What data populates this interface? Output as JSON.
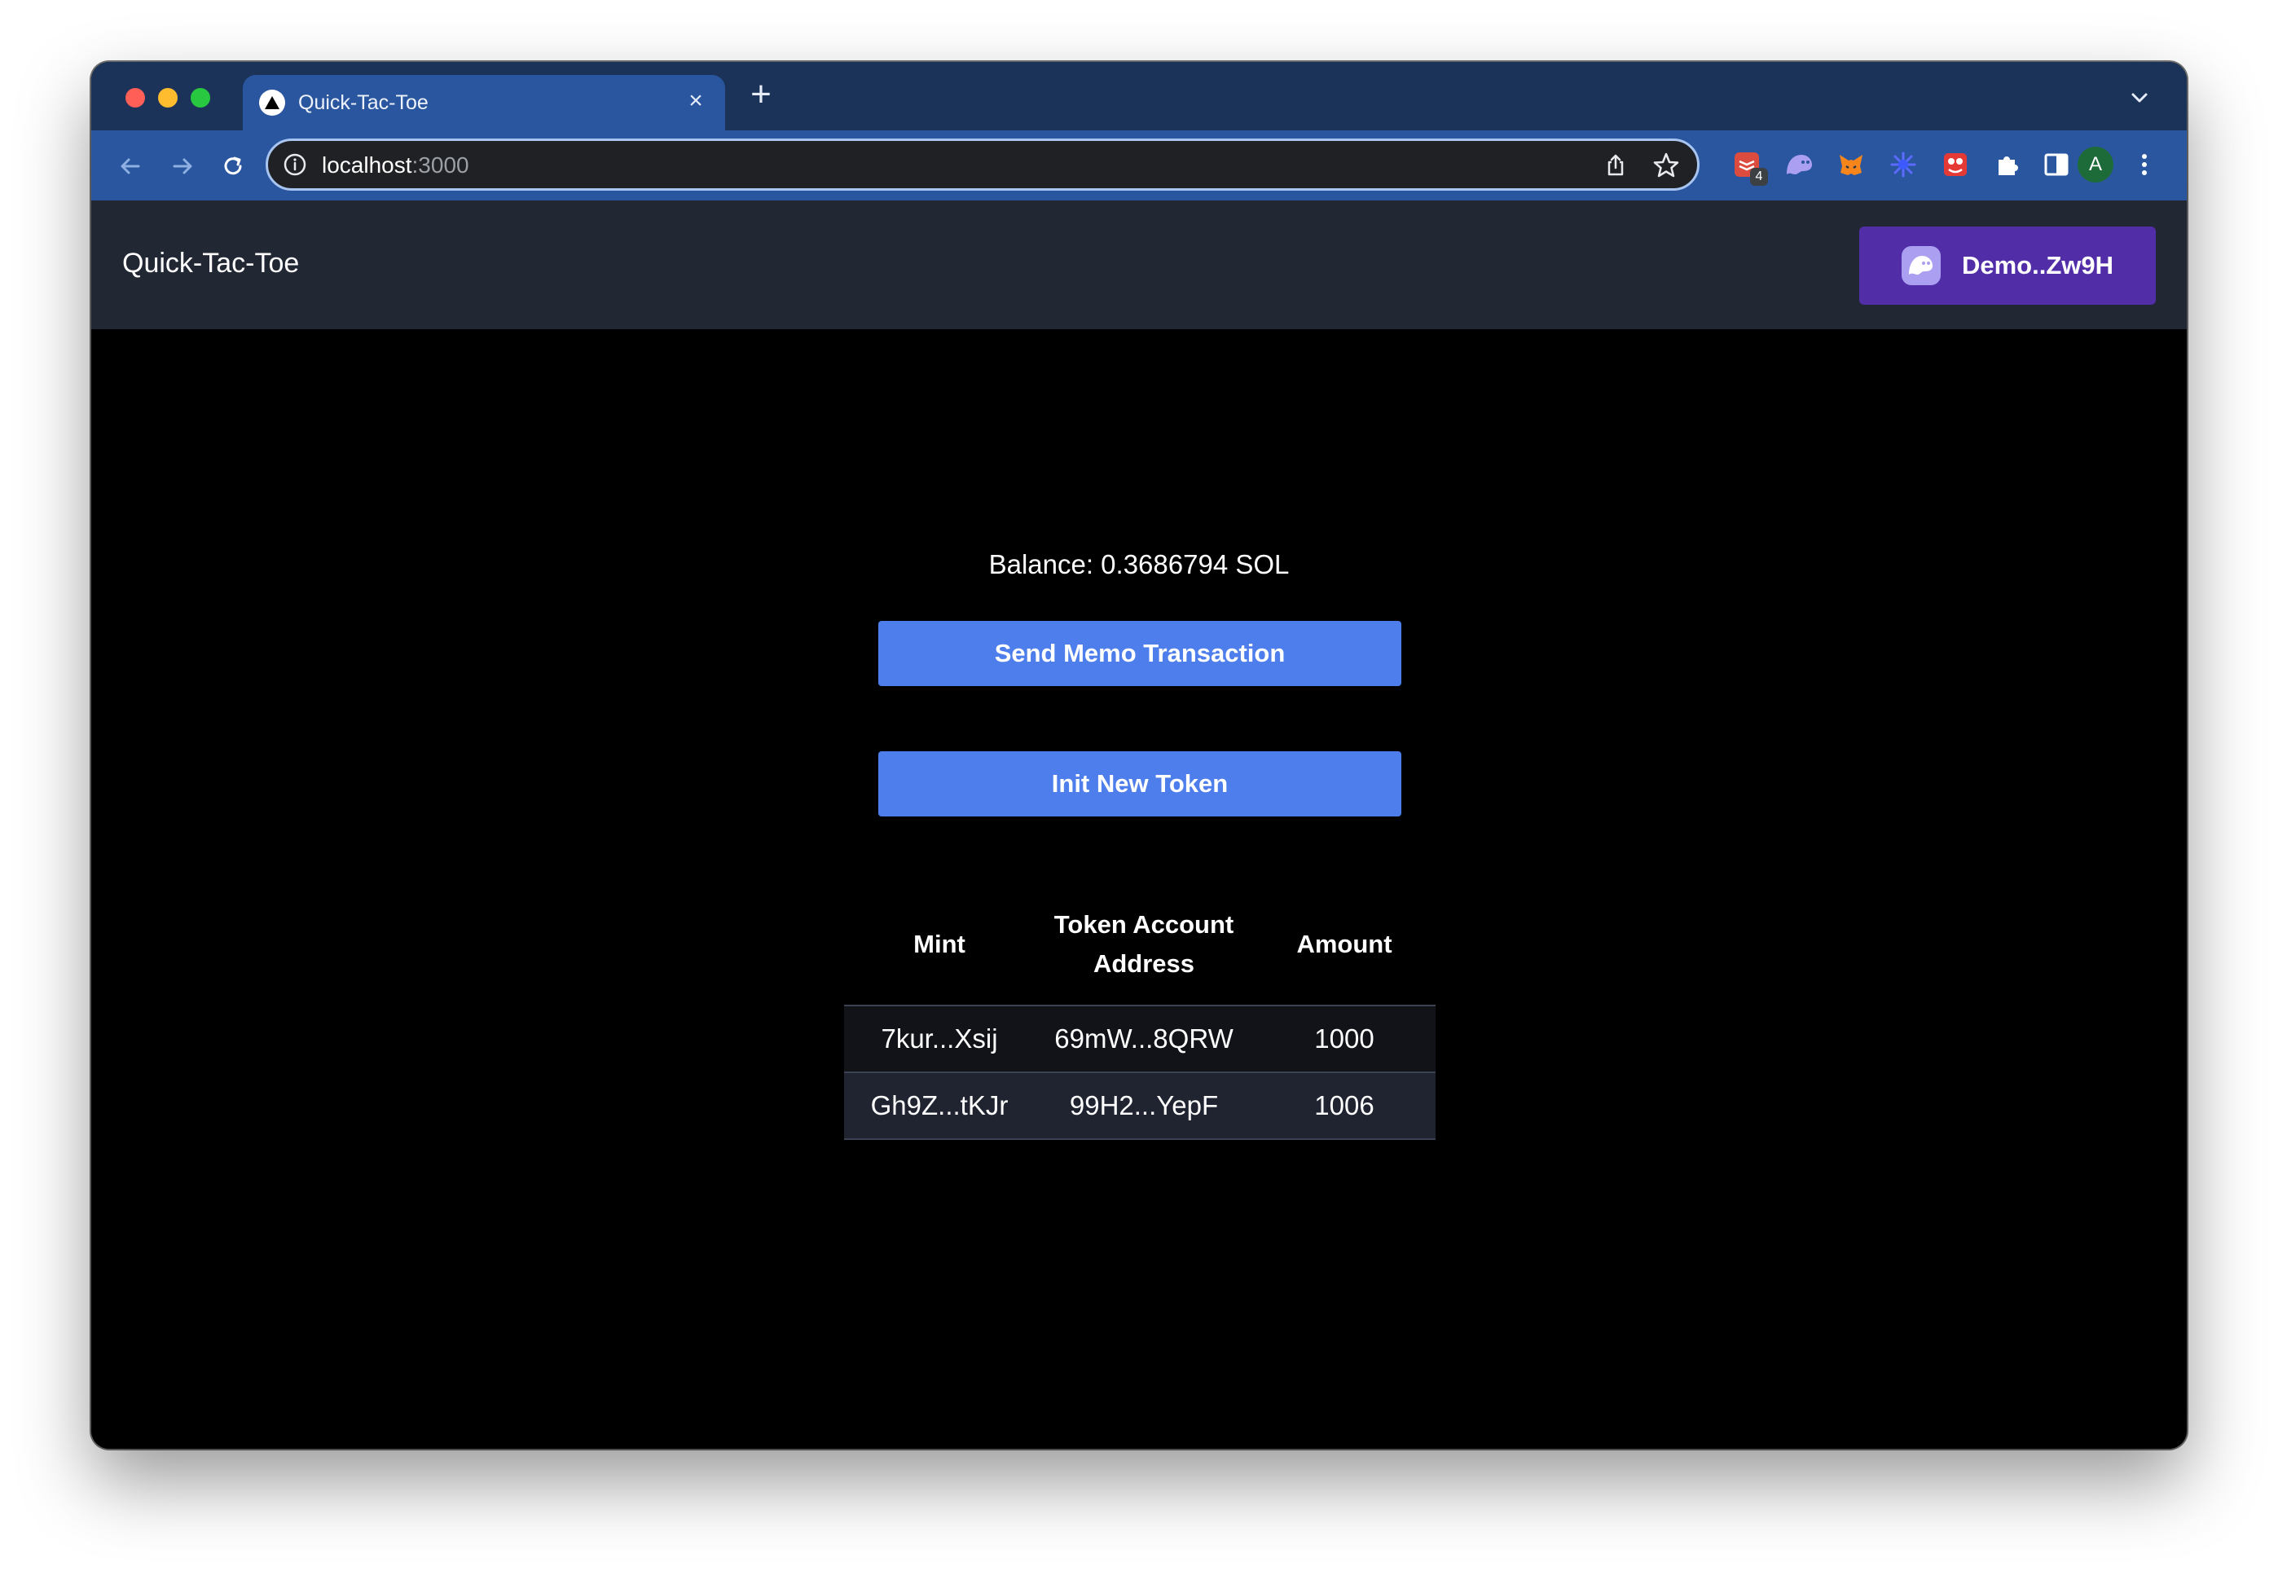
{
  "browser": {
    "tab": {
      "title": "Quick-Tac-Toe",
      "close_glyph": "×"
    },
    "new_tab_glyph": "+",
    "address": {
      "host": "localhost",
      "port": ":3000"
    },
    "extensions": [
      {
        "name": "todoist-icon",
        "color": "#db4c3f",
        "badge": "4"
      },
      {
        "name": "phantom-icon",
        "color": "#ab9ff2"
      },
      {
        "name": "metamask-icon",
        "color": "#f6851b"
      },
      {
        "name": "gear-ext-icon",
        "color": "#3d5afe"
      },
      {
        "name": "ext-red-icon",
        "color": "#e53935"
      },
      {
        "name": "puzzle-icon",
        "color": "#ffffff"
      },
      {
        "name": "sidepanel-icon",
        "color": "#ffffff"
      }
    ],
    "profile_initial": "A"
  },
  "header": {
    "brand": "Quick-Tac-Toe",
    "wallet_label": "Demo..Zw9H"
  },
  "main": {
    "balance": "Balance: 0.3686794 SOL",
    "send_memo_label": "Send Memo Transaction",
    "init_token_label": "Init New Token",
    "table": {
      "headers": [
        "Mint",
        "Token Account Address",
        "Amount"
      ],
      "rows": [
        [
          "7kur...Xsij",
          "69mW...8QRW",
          "1000"
        ],
        [
          "Gh9Z...tKJr",
          "99H2...YepF",
          "1006"
        ]
      ]
    }
  },
  "colors": {
    "tab_strip": "#1b3358",
    "toolbar": "#2a56a0",
    "app_header": "#222734",
    "wallet_button": "#512da8",
    "action_button": "#4e7eeb",
    "page_bg": "#000000"
  }
}
